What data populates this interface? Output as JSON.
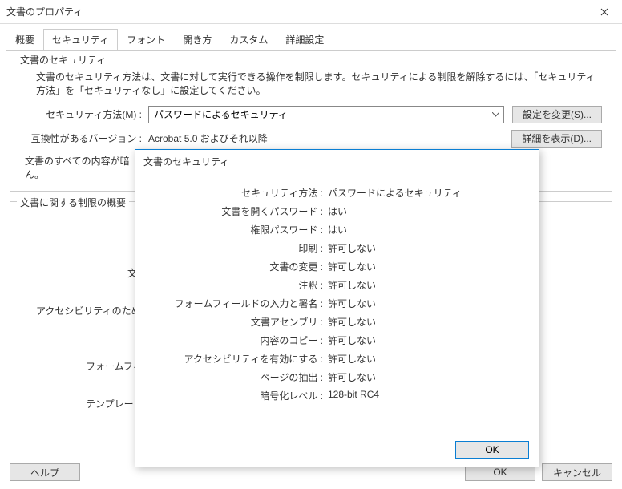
{
  "window": {
    "title": "文書のプロパティ"
  },
  "tabs": [
    {
      "label": "概要"
    },
    {
      "label": "セキュリティ"
    },
    {
      "label": "フォント"
    },
    {
      "label": "開き方"
    },
    {
      "label": "カスタム"
    },
    {
      "label": "詳細設定"
    }
  ],
  "active_tab": 1,
  "security_group": {
    "legend": "文書のセキュリティ",
    "description": "文書のセキュリティ方法は、文書に対して実行できる操作を制限します。セキュリティによる制限を解除するには、「セキュリティ方法」を「セキュリティなし」に設定してください。",
    "method_label": "セキュリティ方法(M) :",
    "method_value": "パスワードによるセキュリティ",
    "change_settings": "設定を変更(S)...",
    "compat_label": "互換性があるバージョン :",
    "compat_value": "Acrobat 5.0 およびそれ以降",
    "show_details": "詳細を表示(D)...",
    "truncated": "文書のすべての内容が暗\nん。"
  },
  "restrictions_group": {
    "legend": "文書に関する制限の概要",
    "lines": [
      "文",
      "アクセシビリティのための",
      "フォームフィ",
      "テンプレート"
    ]
  },
  "modal": {
    "title": "文書のセキュリティ",
    "rows": [
      {
        "label": "セキュリティ方法 :",
        "value": "パスワードによるセキュリティ"
      },
      {
        "label": "文書を開くパスワード :",
        "value": "はい"
      },
      {
        "label": "権限パスワード :",
        "value": "はい"
      },
      {
        "label": "印刷 :",
        "value": "許可しない"
      },
      {
        "label": "文書の変更 :",
        "value": "許可しない"
      },
      {
        "label": "注釈 :",
        "value": "許可しない"
      },
      {
        "label": "フォームフィールドの入力と署名 :",
        "value": "許可しない"
      },
      {
        "label": "文書アセンブリ :",
        "value": "許可しない"
      },
      {
        "label": "内容のコピー :",
        "value": "許可しない"
      },
      {
        "label": "アクセシビリティを有効にする :",
        "value": "許可しない"
      },
      {
        "label": "ページの抽出 :",
        "value": "許可しない"
      },
      {
        "label": "暗号化レベル :",
        "value": "128-bit RC4"
      }
    ],
    "ok": "OK"
  },
  "footer": {
    "help": "ヘルプ",
    "ok": "OK",
    "cancel": "キャンセル"
  }
}
